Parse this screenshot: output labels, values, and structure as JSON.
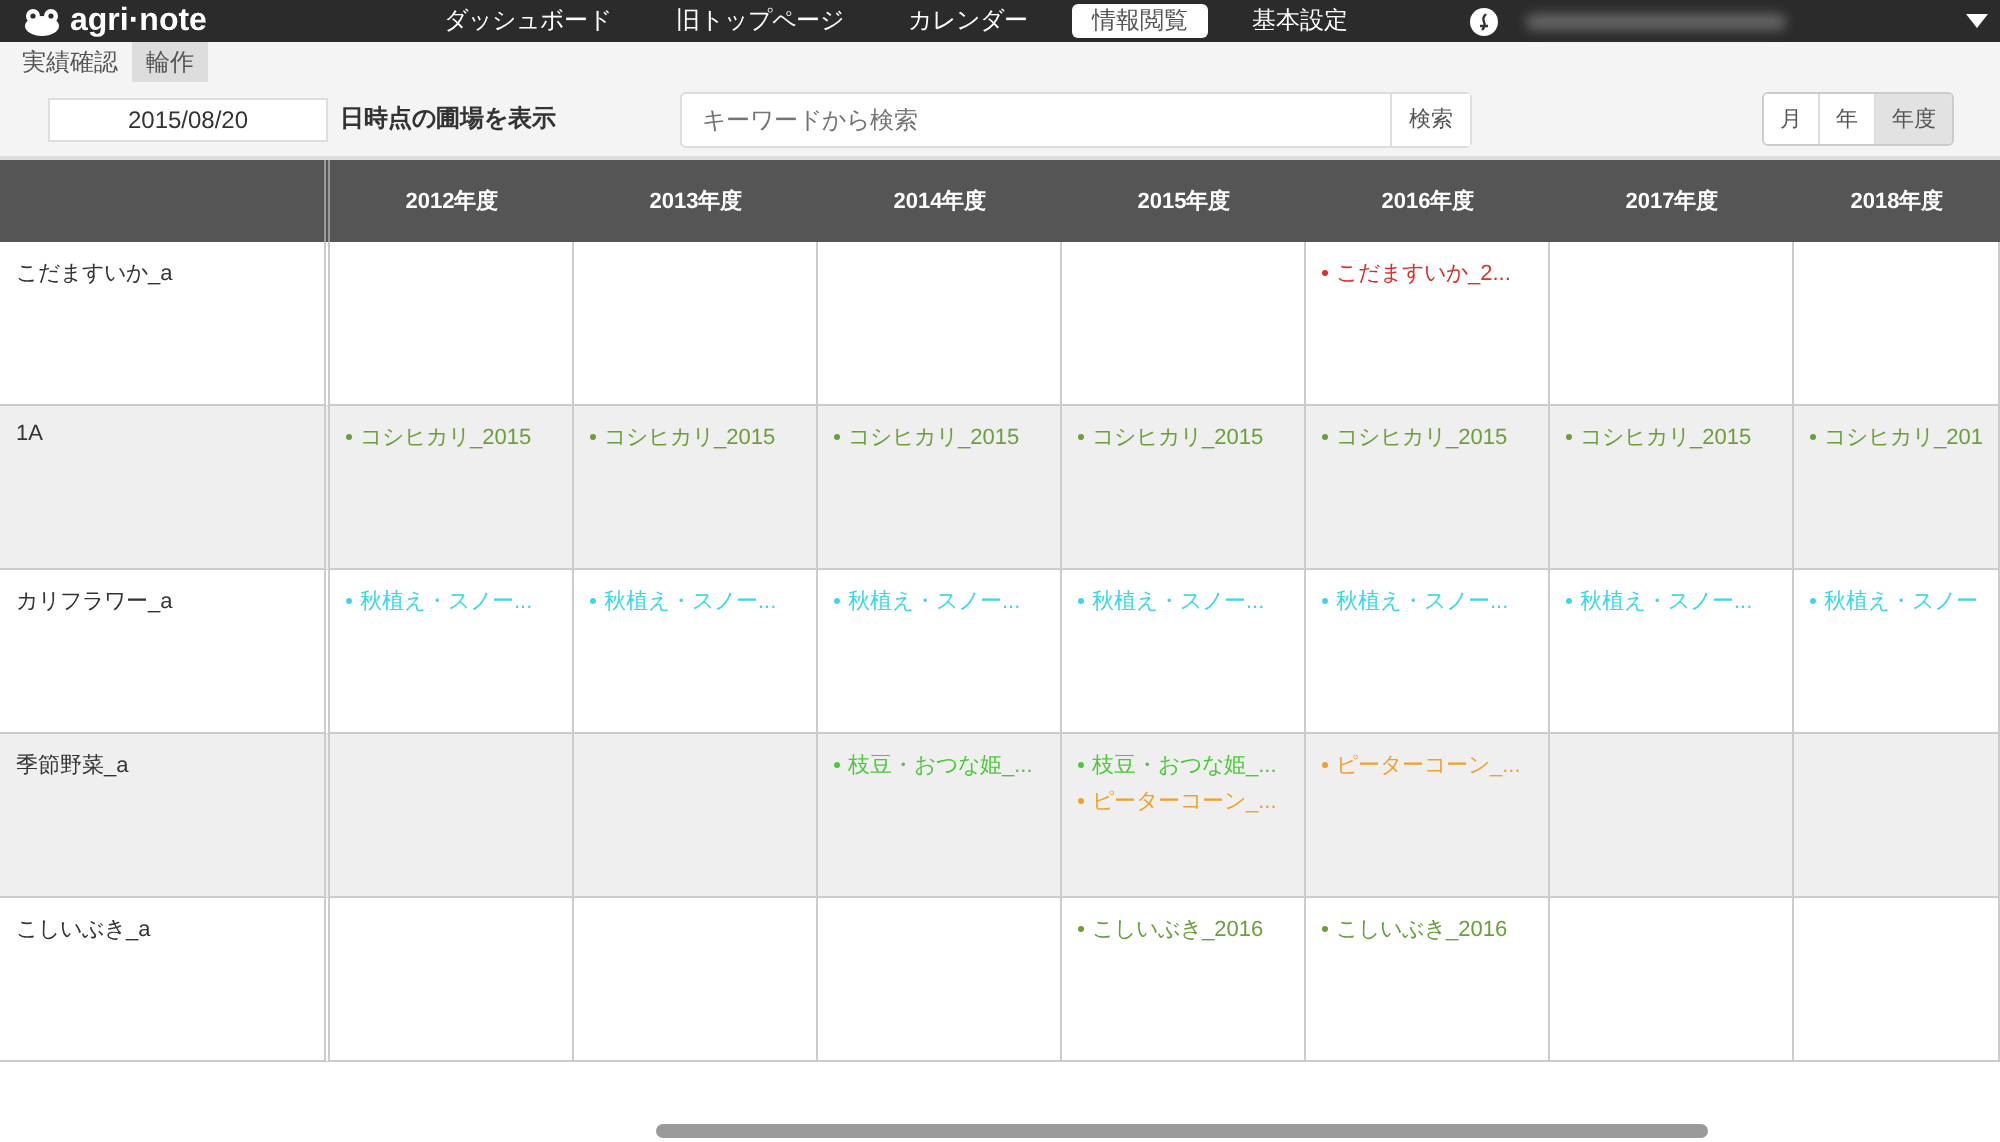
{
  "app": {
    "logo": "agri·note"
  },
  "nav": [
    {
      "label": "ダッシュボード",
      "selected": false
    },
    {
      "label": "旧トップページ",
      "selected": false
    },
    {
      "label": "カレンダー",
      "selected": false
    },
    {
      "label": "情報閲覧",
      "selected": true
    },
    {
      "label": "基本設定",
      "selected": false
    }
  ],
  "subtabs": [
    {
      "label": "実績確認",
      "selected": false
    },
    {
      "label": "輪作",
      "selected": true
    }
  ],
  "toolbar": {
    "date": "2015/08/20",
    "date_suffix": "日時点の圃場を表示",
    "search": {
      "placeholder": "キーワードから検索",
      "button": "検索"
    },
    "periods": [
      {
        "label": "月",
        "selected": false
      },
      {
        "label": "年",
        "selected": false
      },
      {
        "label": "年度",
        "selected": true
      }
    ]
  },
  "table": {
    "columns": [
      "2012年度",
      "2013年度",
      "2014年度",
      "2015年度",
      "2016年度",
      "2017年度",
      "2018年度"
    ],
    "rows": [
      {
        "name": "こだますいか_a",
        "cells": [
          [],
          [],
          [],
          [],
          [
            {
              "text": "こだますいか_2...",
              "color": "#d9302c"
            }
          ],
          [],
          []
        ]
      },
      {
        "name": "1A",
        "cells": [
          [
            {
              "text": "コシヒカリ_2015",
              "color": "#6a9f3a"
            }
          ],
          [
            {
              "text": "コシヒカリ_2015",
              "color": "#6a9f3a"
            }
          ],
          [
            {
              "text": "コシヒカリ_2015",
              "color": "#6a9f3a"
            }
          ],
          [
            {
              "text": "コシヒカリ_2015",
              "color": "#6a9f3a"
            }
          ],
          [
            {
              "text": "コシヒカリ_2015",
              "color": "#6a9f3a"
            }
          ],
          [
            {
              "text": "コシヒカリ_2015",
              "color": "#6a9f3a"
            }
          ],
          [
            {
              "text": "コシヒカリ_201",
              "color": "#6a9f3a"
            }
          ]
        ]
      },
      {
        "name": "カリフラワー_a",
        "cells": [
          [
            {
              "text": "秋植え・スノー...",
              "color": "#3fd6ea"
            }
          ],
          [
            {
              "text": "秋植え・スノー...",
              "color": "#3fd6ea"
            }
          ],
          [
            {
              "text": "秋植え・スノー...",
              "color": "#3fd6ea"
            }
          ],
          [
            {
              "text": "秋植え・スノー...",
              "color": "#3fd6ea"
            }
          ],
          [
            {
              "text": "秋植え・スノー...",
              "color": "#3fd6ea"
            }
          ],
          [
            {
              "text": "秋植え・スノー...",
              "color": "#3fd6ea"
            }
          ],
          [
            {
              "text": "秋植え・スノー",
              "color": "#3fd6ea"
            }
          ]
        ]
      },
      {
        "name": "季節野菜_a",
        "cells": [
          [],
          [],
          [
            {
              "text": "枝豆・おつな姫_...",
              "color": "#4cc93a"
            }
          ],
          [
            {
              "text": "枝豆・おつな姫_...",
              "color": "#4cc93a"
            },
            {
              "text": "ピーターコーン_...",
              "color": "#f0a030"
            }
          ],
          [
            {
              "text": "ピーターコーン_...",
              "color": "#f0a030"
            }
          ],
          [],
          []
        ]
      },
      {
        "name": "こしいぶき_a",
        "cells": [
          [],
          [],
          [],
          [
            {
              "text": "こしいぶき_2016",
              "color": "#6a9f3a"
            }
          ],
          [
            {
              "text": "こしいぶき_2016",
              "color": "#6a9f3a"
            }
          ],
          [],
          []
        ]
      }
    ]
  }
}
